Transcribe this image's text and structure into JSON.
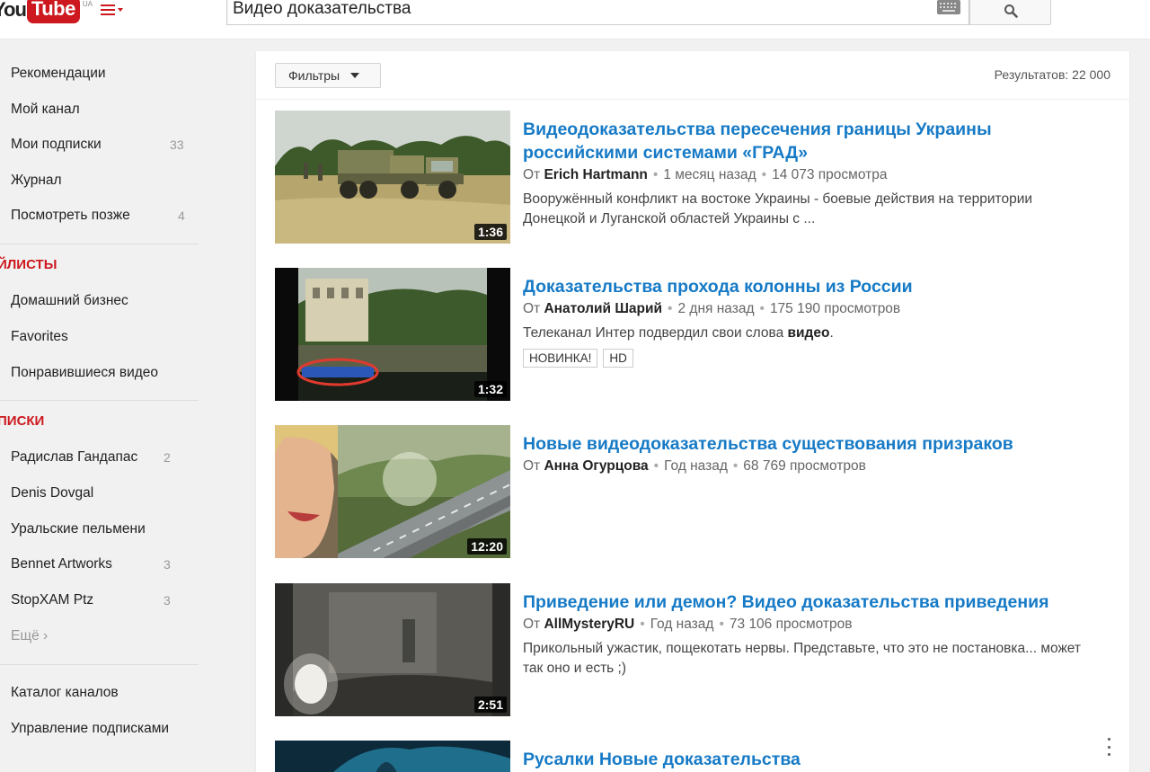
{
  "header": {
    "logo_you": "You",
    "logo_tube": "Tube",
    "logo_sup": "UA",
    "search_value": "Видео доказательства"
  },
  "sidebar": {
    "main_items": [
      {
        "label": "Рекомендации"
      },
      {
        "label": "Мой канал"
      },
      {
        "label": "Мои подписки",
        "count": "33"
      },
      {
        "label": "Журнал"
      },
      {
        "label": "Посмотреть позже",
        "count": "4"
      }
    ],
    "playlists_heading": "ЙЛИСТЫ",
    "playlists": [
      {
        "label": "Домашний бизнес"
      },
      {
        "label": "Favorites"
      },
      {
        "label": "Понравившиеся видео"
      }
    ],
    "subscriptions_heading": "ПИСКИ",
    "subscriptions": [
      {
        "label": "Радислав Гандапас",
        "count": "2"
      },
      {
        "label": "Denis Dovgal"
      },
      {
        "label": "Уральские пельмени"
      },
      {
        "label": "Bennet Artworks",
        "count": "3"
      },
      {
        "label": "StopXAM Ptz",
        "count": "3"
      }
    ],
    "more_label": "Ещё ›",
    "bottom_items": [
      {
        "label": "Каталог каналов"
      },
      {
        "label": "Управление подписками"
      }
    ]
  },
  "results": {
    "filter_label": "Фильтры",
    "count_label": "Результатов: 22 000",
    "items": [
      {
        "title": "Видеодоказательства пересечения границы Украины российскими системами «ГРАД»",
        "from": "От",
        "channel": "Erich Hartmann",
        "age": "1 месяц назад",
        "views": "14 073 просмотра",
        "desc": "Вооружённый конфликт на востоке Украины - боевые действия на территории Донецкой и Луганской областей Украины с ...",
        "duration": "1:36"
      },
      {
        "title": "Доказательства прохода колонны из России",
        "from": "От",
        "channel": "Анатолий Шарий",
        "age": "2 дня назад",
        "views": "175 190 просмотров",
        "desc_pre": "Телеканал Интер подвердил свои слова ",
        "desc_bold": "видео",
        "desc_post": ".",
        "badge_new": "НОВИНКА!",
        "badge_hd": "HD",
        "duration": "1:32"
      },
      {
        "title": "Новые видеодоказательства существования призраков",
        "from": "От",
        "channel": "Анна Огурцова",
        "age": "Год назад",
        "views": "68 769 просмотров",
        "duration": "12:20"
      },
      {
        "title": "Приведение или демон? Видео доказательства приведения",
        "from": "От",
        "channel": "AllMysteryRU",
        "age": "Год назад",
        "views": "73 106 просмотров",
        "desc": "Прикольный ужастик, пощекотать нервы. Представьте, что это не постановка... может так оно и есть ;)",
        "duration": "2:51"
      },
      {
        "title": "Русалки Новые доказательства"
      }
    ]
  }
}
